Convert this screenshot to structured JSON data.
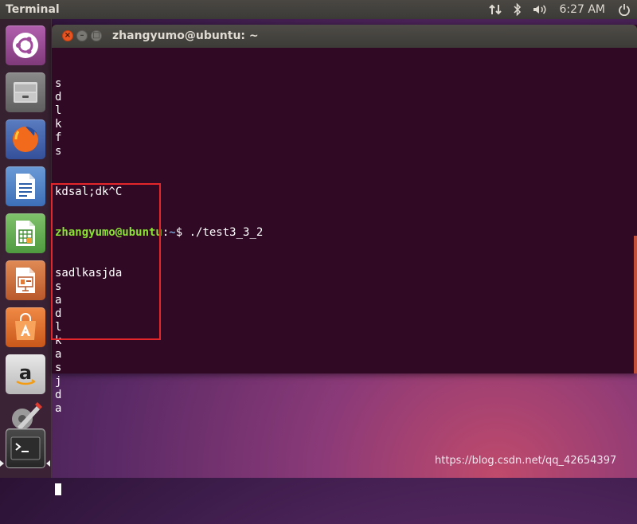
{
  "panel": {
    "app_name": "Terminal",
    "clock": "6:27 AM",
    "indicators": [
      "network-icon",
      "bluetooth-icon",
      "volume-icon",
      "power-icon"
    ]
  },
  "launcher": {
    "items": [
      "ubuntu-dash-icon",
      "files-icon",
      "firefox-icon",
      "libreoffice-writer-icon",
      "libreoffice-calc-icon",
      "libreoffice-impress-icon",
      "ubuntu-software-icon",
      "amazon-icon",
      "system-settings-icon",
      "terminal-icon"
    ]
  },
  "window": {
    "title": "zhangyumo@ubuntu: ~"
  },
  "terminal": {
    "lines_before": [
      "s",
      "d",
      "l",
      "k",
      "f",
      "s",
      "",
      "",
      "kdsal;dk^C"
    ],
    "prompt": {
      "user_host": "zhangyumo@ubuntu",
      "separator": ":",
      "path": "~",
      "symbol": "$ ",
      "command": "./test3_3_2"
    },
    "output_lines": [
      "sadlkasjda",
      "s",
      "a",
      "d",
      "l",
      "k",
      "a",
      "s",
      "j",
      "d",
      "a"
    ],
    "after_blank": [
      ""
    ]
  },
  "colors": {
    "terminal_bg": "#300a24",
    "prompt_user": "#8ae234",
    "prompt_path": "#729fcf",
    "highlight": "#e3262a",
    "accent": "#e95420"
  },
  "watermark": "https://blog.csdn.net/qq_42654397"
}
